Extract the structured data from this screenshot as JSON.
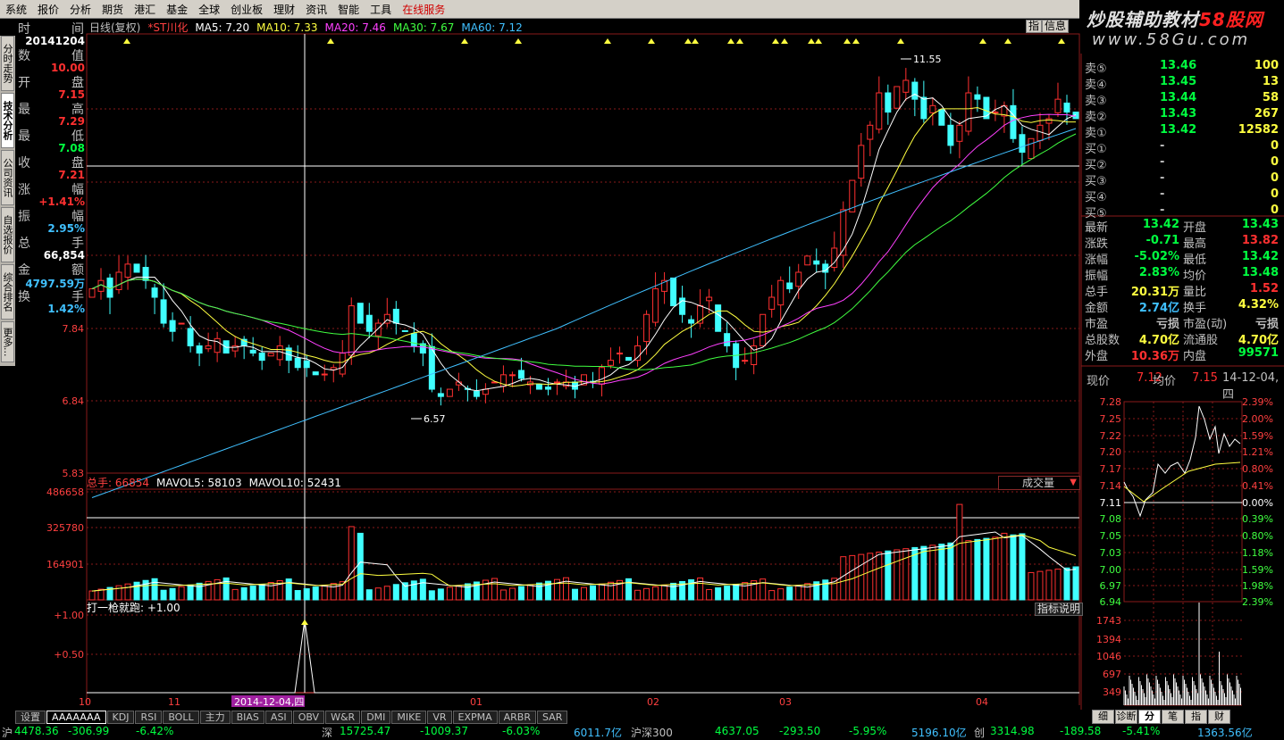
{
  "menu": [
    "系统",
    "报价",
    "分析",
    "期货",
    "港汇",
    "基金",
    "全球",
    "创业板",
    "理财",
    "资讯",
    "智能",
    "工具",
    "在线服务"
  ],
  "brand": {
    "line1a": "炒股辅助教材",
    "line1b": "58股网",
    "line2": "www.58Gu.com"
  },
  "side_tabs": [
    "分时走势",
    "技术分析",
    "公司资讯",
    "自选报价",
    "综合排名",
    "更多..."
  ],
  "side_tab_active": 1,
  "info_pairs": [
    {
      "l": "时",
      "r": "间",
      "v": "20141204",
      "c": "#ffffff"
    },
    {
      "l": "数",
      "r": "值",
      "v": "10.00",
      "c": "#ff3030"
    },
    {
      "l": "开",
      "r": "盘",
      "v": "7.15",
      "c": "#ff3030"
    },
    {
      "l": "最",
      "r": "高",
      "v": "7.29",
      "c": "#ff3030"
    },
    {
      "l": "最",
      "r": "低",
      "v": "7.08",
      "c": "#00ff40"
    },
    {
      "l": "收",
      "r": "盘",
      "v": "7.21",
      "c": "#ff3030"
    },
    {
      "l": "涨",
      "r": "幅",
      "v": "+1.41%",
      "c": "#ff3030"
    },
    {
      "l": "振",
      "r": "幅",
      "v": "2.95%",
      "c": "#40c0ff"
    },
    {
      "l": "总",
      "r": "手",
      "v": "66,854",
      "c": "#ffffff"
    },
    {
      "l": "金",
      "r": "额",
      "v": "4797.59万",
      "c": "#40c0ff"
    },
    {
      "l": "换",
      "r": "手",
      "v": "1.42%",
      "c": "#40c0ff"
    }
  ],
  "chart_title": {
    "name": "*ST川化",
    "period": "日线(复权)",
    "ma": [
      {
        "t": "MA5: 7.20",
        "c": "#ffffff"
      },
      {
        "t": "MA10: 7.33",
        "c": "#ffff40"
      },
      {
        "t": "MA20: 7.46",
        "c": "#ff40ff"
      },
      {
        "t": "MA30: 7.67",
        "c": "#40ff40"
      },
      {
        "t": "MA60: 7.12",
        "c": "#40c0ff"
      }
    ]
  },
  "top_buttons": [
    "指",
    "信息"
  ],
  "price_axis": [
    "7.84",
    "6.84",
    "5.83"
  ],
  "price_annotations": {
    "high": "11.55",
    "low": "6.57"
  },
  "vol_title": {
    "a": "总手: 66854",
    "b": "MAVOL5: 58103",
    "c": "MAVOL10: 52431"
  },
  "vol_axis": [
    "486658",
    "325780",
    "164901"
  ],
  "vol_dropdown": "成交量",
  "ind_title": "打一枪就跑: +1.00",
  "ind_axis": [
    "+1.00",
    "+0.50"
  ],
  "ind_help": "指标说明",
  "x_labels": [
    "10",
    "11",
    "2014-12-04,四",
    "01",
    "02",
    "03",
    "04"
  ],
  "bottom_tabs": [
    "设置",
    "AAAAAAA",
    "KDJ",
    "RSI",
    "BOLL",
    "主力",
    "BIAS",
    "ASI",
    "OBV",
    "W&R",
    "DMI",
    "MIKE",
    "VR",
    "EXPMA",
    "ARBR",
    "SAR"
  ],
  "bottom_tab_active": 1,
  "right_tabs": [
    "细",
    "诊断",
    "分",
    "笔",
    "指",
    "财"
  ],
  "right_tab_active": 2,
  "orderbook": [
    {
      "l": "卖⑤",
      "p": "13.46",
      "v": "100"
    },
    {
      "l": "卖④",
      "p": "13.45",
      "v": "13"
    },
    {
      "l": "卖③",
      "p": "13.44",
      "v": "58"
    },
    {
      "l": "卖②",
      "p": "13.43",
      "v": "267"
    },
    {
      "l": "卖①",
      "p": "13.42",
      "v": "12582"
    },
    {
      "l": "买①",
      "p": "-",
      "v": "0"
    },
    {
      "l": "买②",
      "p": "-",
      "v": "0"
    },
    {
      "l": "买③",
      "p": "-",
      "v": "0"
    },
    {
      "l": "买④",
      "p": "-",
      "v": "0"
    },
    {
      "l": "买⑤",
      "p": "-",
      "v": "0"
    }
  ],
  "stats": [
    {
      "a": "最新",
      "av": "13.42",
      "ac": "#00ff40",
      "b": "开盘",
      "bv": "13.43",
      "bc": "#00ff40"
    },
    {
      "a": "涨跌",
      "av": "-0.71",
      "ac": "#00ff40",
      "b": "最高",
      "bv": "13.82",
      "bc": "#ff3030"
    },
    {
      "a": "涨幅",
      "av": "-5.02%",
      "ac": "#00ff40",
      "b": "最低",
      "bv": "13.42",
      "bc": "#00ff40"
    },
    {
      "a": "振幅",
      "av": "2.83%",
      "ac": "#00ff40",
      "b": "均价",
      "bv": "13.48",
      "bc": "#00ff40"
    },
    {
      "a": "总手",
      "av": "20.31万",
      "ac": "#ffff40",
      "b": "量比",
      "bv": "1.52",
      "bc": "#ff3030"
    },
    {
      "a": "金额",
      "av": "2.74亿",
      "ac": "#40c0ff",
      "b": "换手",
      "bv": "4.32%",
      "bc": "#ffff40"
    },
    {
      "a": "市盈",
      "av": "亏损",
      "ac": "#c0c0c0",
      "b": "市盈(动)",
      "bv": "亏损",
      "bc": "#c0c0c0"
    },
    {
      "a": "总股数",
      "av": "4.70亿",
      "ac": "#ffff40",
      "b": "流通股",
      "bv": "4.70亿",
      "bc": "#ffff40"
    },
    {
      "a": "外盘",
      "av": "10.36万",
      "ac": "#ff3030",
      "b": "内盘",
      "bv": "99571",
      "bc": "#00ff40"
    }
  ],
  "mini_header": {
    "now_lbl": "现价",
    "now": "7.12",
    "avg_lbl": "均价",
    "avg": "7.15",
    "date": "14-12-04,四"
  },
  "mini_price_axis": [
    "7.28",
    "7.25",
    "7.22",
    "7.20",
    "7.17",
    "7.14",
    "7.11",
    "7.08",
    "7.05",
    "7.03",
    "7.00",
    "6.97",
    "6.94"
  ],
  "mini_pct_axis": [
    "2.39%",
    "2.00%",
    "1.59%",
    "1.21%",
    "0.80%",
    "0.41%",
    "0.00%",
    "0.39%",
    "0.80%",
    "1.18%",
    "1.59%",
    "1.98%",
    "2.39%"
  ],
  "mini_vol_axis": [
    "1743",
    "1394",
    "1046",
    "697",
    "349"
  ],
  "status": [
    {
      "t": "沪",
      "c": "#c0c0c0"
    },
    {
      "t": "4478.36",
      "c": "#00ff40"
    },
    {
      "t": "-306.99",
      "c": "#00ff40"
    },
    {
      "t": "-6.42%",
      "c": "#00ff40"
    },
    {
      "t": "深",
      "c": "#c0c0c0"
    },
    {
      "t": "15725.47",
      "c": "#00ff40"
    },
    {
      "t": "-1009.37",
      "c": "#00ff40"
    },
    {
      "t": "-6.03%",
      "c": "#00ff40"
    },
    {
      "t": "6011.7亿",
      "c": "#40c0ff"
    },
    {
      "t": "沪深300",
      "c": "#c0c0c0"
    },
    {
      "t": "4637.05",
      "c": "#00ff40"
    },
    {
      "t": "-293.50",
      "c": "#00ff40"
    },
    {
      "t": "-5.95%",
      "c": "#00ff40"
    },
    {
      "t": "5196.10亿",
      "c": "#40c0ff"
    },
    {
      "t": "创",
      "c": "#c0c0c0"
    },
    {
      "t": "3314.98",
      "c": "#00ff40"
    },
    {
      "t": "-189.58",
      "c": "#00ff40"
    },
    {
      "t": "-5.41%",
      "c": "#00ff40"
    },
    {
      "t": "1363.56亿",
      "c": "#40c0ff"
    }
  ],
  "chart_data": {
    "type": "candlestick",
    "x_ticks": [
      "10",
      "11",
      "01",
      "02",
      "03",
      "04"
    ],
    "y_ticks": [
      7.84,
      6.84,
      5.83
    ],
    "high_marker": 11.55,
    "low_marker": 6.57,
    "selected_date": "2014-12-04",
    "selected_bar": {
      "open": 7.15,
      "high": 7.29,
      "low": 7.08,
      "close": 7.21
    },
    "ma": {
      "MA5": 7.2,
      "MA10": 7.33,
      "MA20": 7.46,
      "MA30": 7.67,
      "MA60": 7.12
    },
    "volume": {
      "last": 66854,
      "MAVOL5": 58103,
      "MAVOL10": 52431,
      "y_ticks": [
        486658,
        325780,
        164901
      ]
    },
    "indicator": {
      "name": "打一枪就跑",
      "value": 1.0,
      "y_ticks": [
        1.0,
        0.5
      ]
    }
  },
  "colors": {
    "up": "#ff3030",
    "down": "#40ffff",
    "grid": "#8a1a1a",
    "cross": "#ffffff"
  }
}
